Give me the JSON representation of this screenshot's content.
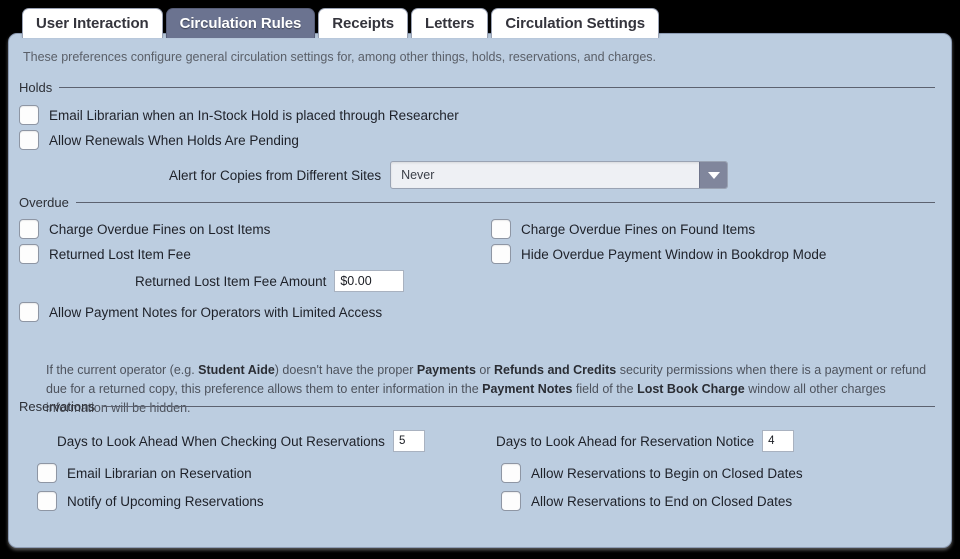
{
  "tabs": [
    {
      "label": "User Interaction",
      "active": false
    },
    {
      "label": "Circulation Rules",
      "active": true
    },
    {
      "label": "Receipts",
      "active": false
    },
    {
      "label": "Letters",
      "active": false
    },
    {
      "label": "Circulation Settings",
      "active": false
    }
  ],
  "intro": "These preferences configure general circulation settings for, among other things, holds, reservations, and charges.",
  "sections": {
    "holds": {
      "label": "Holds",
      "checkboxes": [
        {
          "label": "Email Librarian when an In-Stock Hold is placed through Researcher",
          "checked": false
        },
        {
          "label": "Allow Renewals When Holds Are Pending",
          "checked": false
        }
      ],
      "alert_field": {
        "label": "Alert for Copies from Different Sites",
        "value": "Never"
      }
    },
    "overdue": {
      "label": "Overdue",
      "checkboxes_left": [
        {
          "label": "Charge Overdue Fines on Lost Items",
          "checked": false
        },
        {
          "label": "Returned Lost Item Fee",
          "checked": false
        }
      ],
      "checkboxes_right": [
        {
          "label": "Charge Overdue Fines on Found Items",
          "checked": false
        },
        {
          "label": "Hide Overdue Payment Window in Bookdrop Mode",
          "checked": false
        }
      ],
      "fee_amount": {
        "label": "Returned Lost Item Fee Amount",
        "value": "$0.00"
      },
      "payment_notes": {
        "label": "Allow Payment Notes for Operators with Limited Access",
        "checked": false
      },
      "description": {
        "p1": "If the current operator (e.g. ",
        "b1": "Student Aide",
        "p2": ") doesn't have the proper ",
        "b2": "Payments",
        "p3": " or ",
        "b3": "Refunds and Credits",
        "p4": " security permissions when there is a payment or refund due for a returned copy, this preference allows them to enter information in the ",
        "b4": "Payment Notes",
        "p5": " field of the ",
        "b5": "Lost Book Charge",
        "p6": " window all other charges information will be hidden."
      }
    },
    "reservations": {
      "label": "Reservations",
      "days_checkout": {
        "label": "Days to Look Ahead When Checking Out Reservations",
        "value": "5"
      },
      "days_notice": {
        "label": "Days to Look Ahead for Reservation Notice",
        "value": "4"
      },
      "checkboxes_left": [
        {
          "label": "Email Librarian on Reservation",
          "checked": false
        },
        {
          "label": "Notify of Upcoming Reservations",
          "checked": false
        }
      ],
      "checkboxes_right": [
        {
          "label": "Allow Reservations to Begin on Closed Dates",
          "checked": false
        },
        {
          "label": "Allow Reservations to End on Closed Dates",
          "checked": false
        }
      ]
    }
  },
  "colors": {
    "panel_bg": "#bccde0",
    "active_tab_bg": "#6b7390",
    "tab_bg": "#ffffff",
    "rule": "#5c6270",
    "select_button": "#80869c"
  }
}
